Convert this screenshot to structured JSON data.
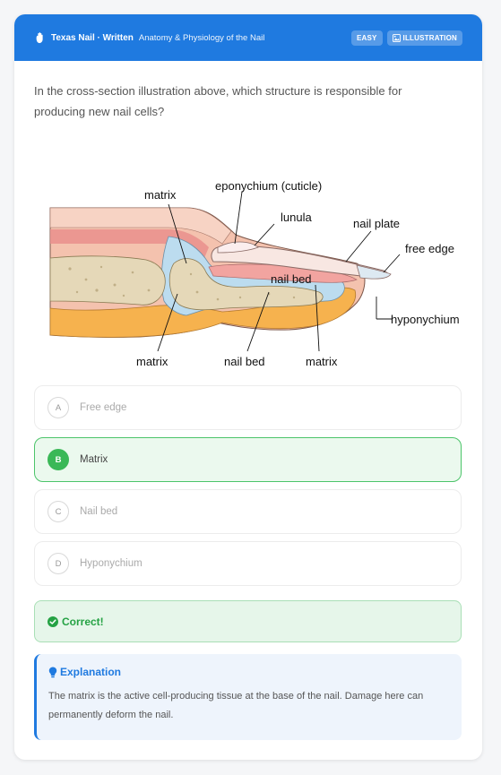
{
  "header": {
    "brand": "Texas Nail · Written",
    "topic": "Anatomy & Physiology of the Nail",
    "badge_difficulty": "EASY",
    "badge_type": "ILLUSTRATION",
    "accent_color": "#1f7ae0",
    "icon": "hand-icon"
  },
  "question": {
    "text": "In the cross-section illustration above, which structure is responsible for producing new nail cells?"
  },
  "figure": {
    "labels": {
      "matrix_top": "matrix",
      "eponychium": "eponychium  (cuticle)",
      "lunula": "lunula",
      "nail_plate": "nail plate",
      "free_edge": "free edge",
      "nail_bed_mid": "nail bed",
      "hyponychium": "hyponychium",
      "matrix_bottom_left": "matrix",
      "nail_bed_bottom": "nail bed",
      "matrix_bottom_right": "matrix"
    }
  },
  "options": [
    {
      "letter": "A",
      "text": "Free edge",
      "state": "default"
    },
    {
      "letter": "B",
      "text": "Matrix",
      "state": "selected"
    },
    {
      "letter": "C",
      "text": "Nail bed",
      "state": "default"
    },
    {
      "letter": "D",
      "text": "Hyponychium",
      "state": "default"
    }
  ],
  "result": {
    "text": "Correct!",
    "color": "#25a244",
    "icon": "check-circle-icon"
  },
  "explanation": {
    "title": "Explanation",
    "body": "The matrix is the active cell-producing tissue at the base of the nail. Damage here can permanently deform the nail.",
    "icon": "lightbulb-icon"
  }
}
